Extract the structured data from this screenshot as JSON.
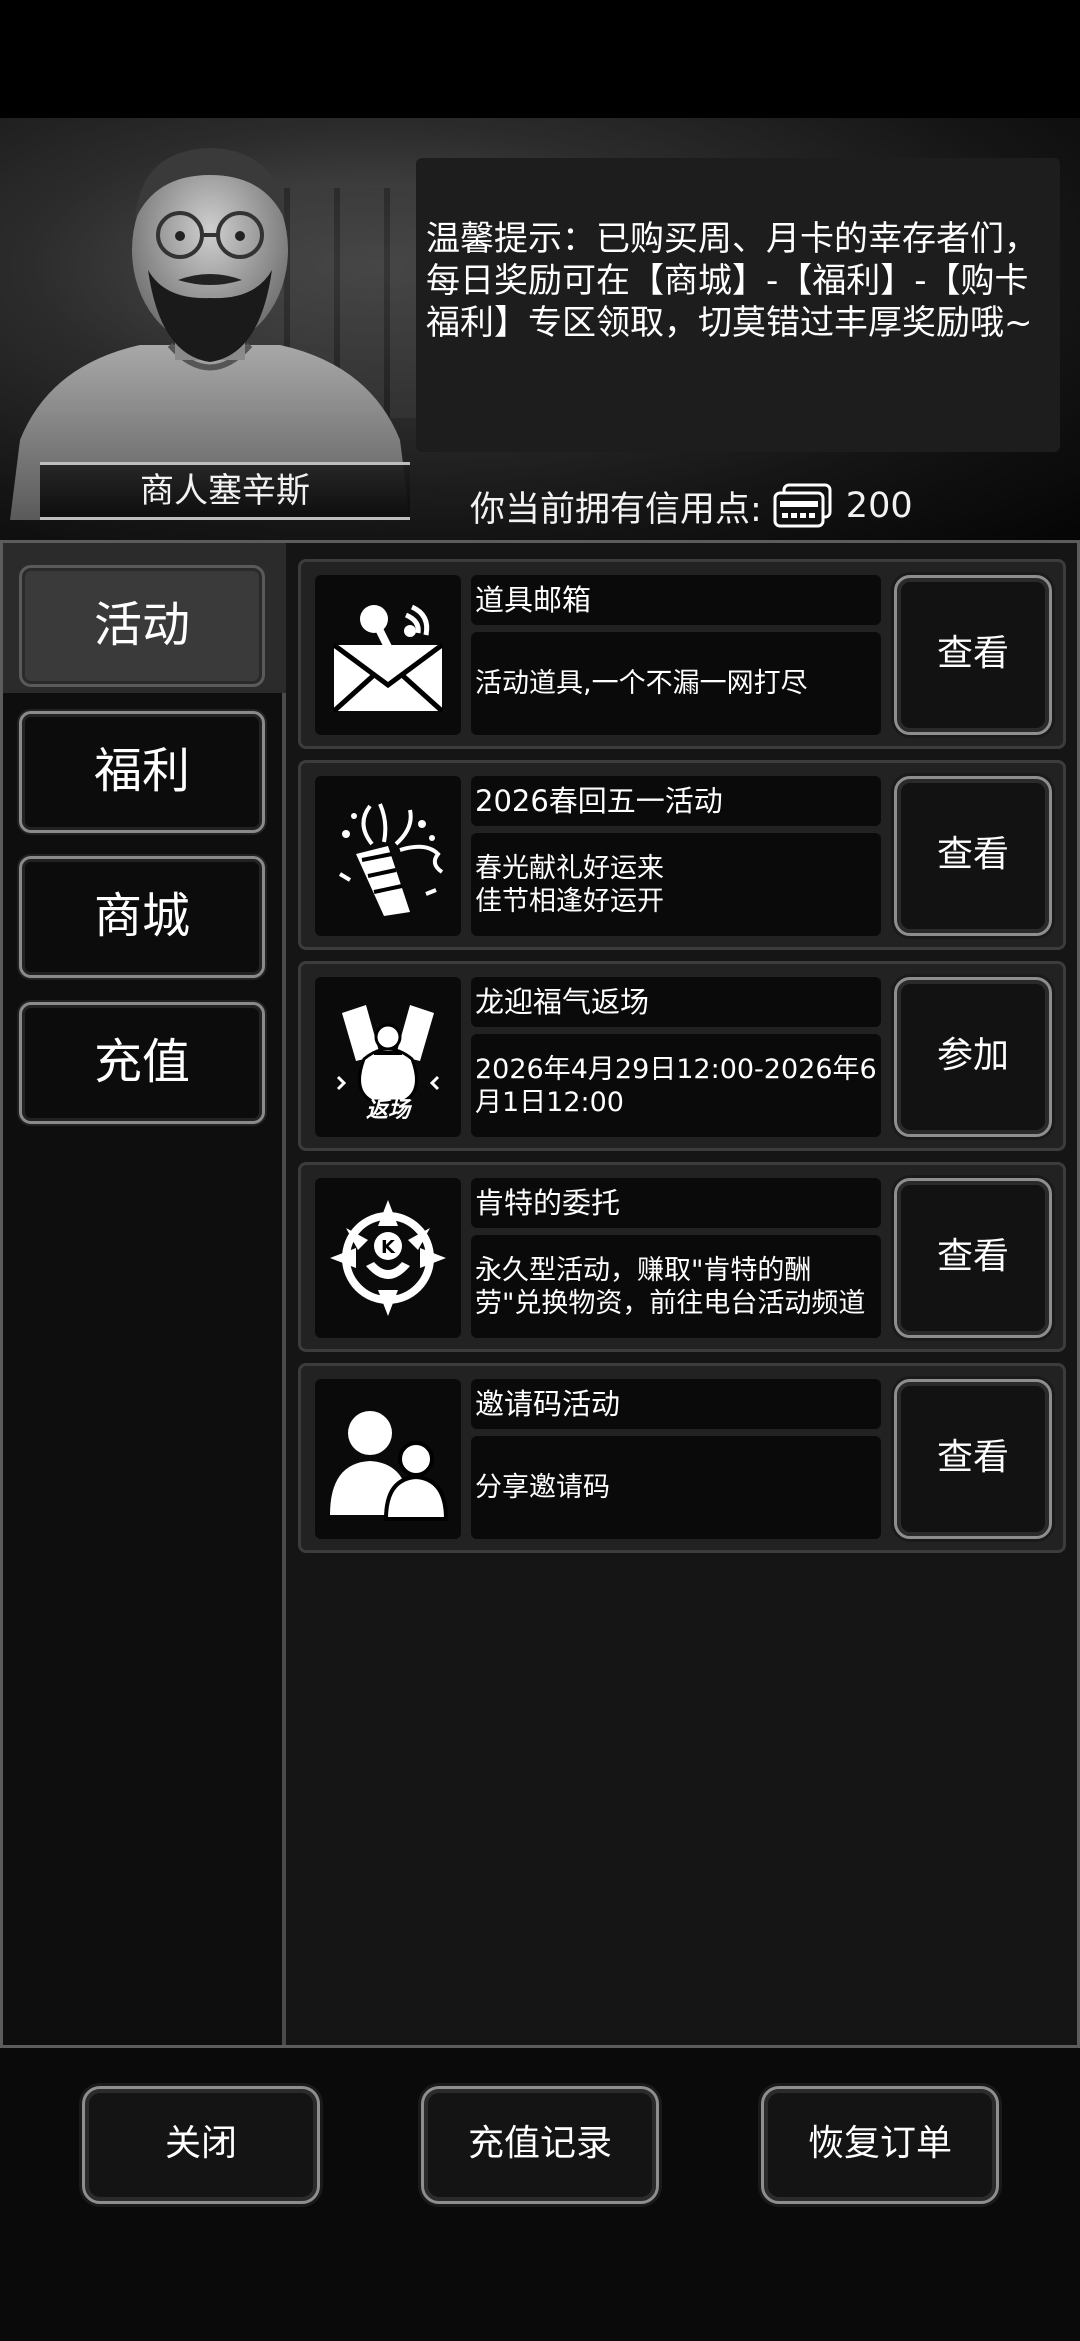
{
  "header": {
    "merchant_name": "商人塞辛斯",
    "tip_text": "温馨提示：已购买周、月卡的幸存者们，每日奖励可在【商城】-【福利】-【购卡福利】专区领取，切莫错过丰厚奖励哦~",
    "credits_label": "你当前拥有信用点:",
    "credits_amount": "200"
  },
  "sidebar": {
    "tabs": [
      {
        "label": "活动",
        "active": true
      },
      {
        "label": "福利",
        "active": false
      },
      {
        "label": "商城",
        "active": false
      },
      {
        "label": "充值",
        "active": false
      }
    ]
  },
  "activities": [
    {
      "icon": "mailbox-icon",
      "title": "道具邮箱",
      "desc": "活动道具,一个不漏一网打尽",
      "action": "查看"
    },
    {
      "icon": "party-popper-icon",
      "title": "2026春回五一活动",
      "desc": "春光献礼好运来\n佳节相逢好运开",
      "action": "查看"
    },
    {
      "icon": "lucky-bag-return-icon",
      "title": "龙迎福气返场",
      "desc": "2026年4月29日12:00-2026年6月1日12:00",
      "action": "参加",
      "badge_text": "返场"
    },
    {
      "icon": "kent-emblem-icon",
      "title": "肯特的委托",
      "desc": "永久型活动，赚取\"肯特的酬劳\"兑换物资，前往电台活动频道",
      "action": "查看"
    },
    {
      "icon": "users-icon",
      "title": "邀请码活动",
      "desc": "分享邀请码",
      "action": "查看"
    }
  ],
  "footer": {
    "close_label": "关闭",
    "recharge_history_label": "充值记录",
    "restore_order_label": "恢复订单"
  }
}
